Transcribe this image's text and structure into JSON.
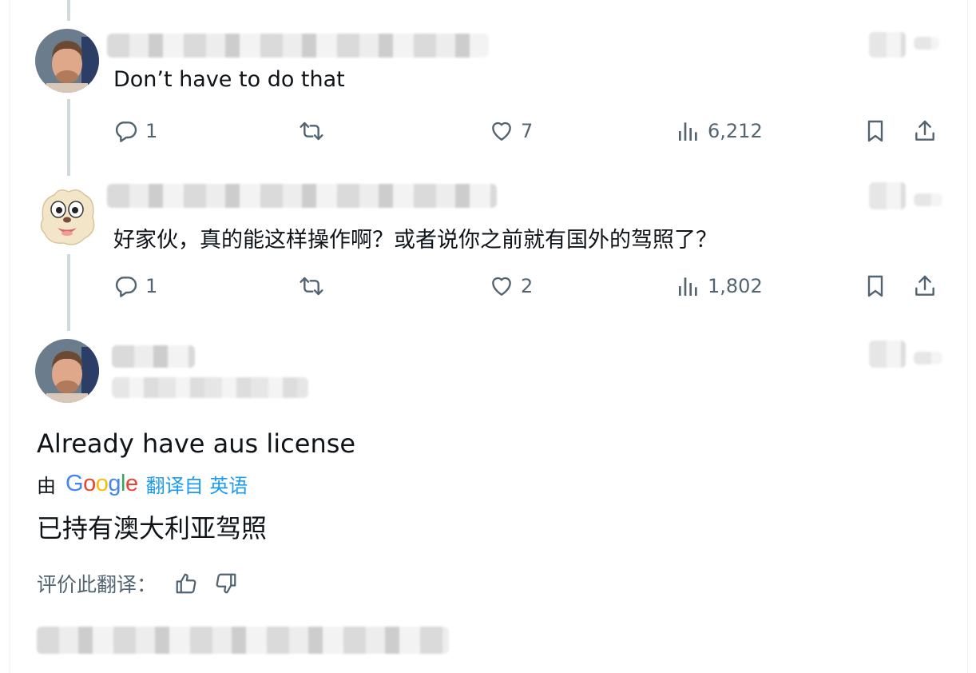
{
  "replies": [
    {
      "text": "Don’t have to do that",
      "replies": "1",
      "likes": "7",
      "views": "6,212"
    },
    {
      "text": "好家伙，真的能这样操作啊？或者说你之前就有国外的驾照了？",
      "replies": "1",
      "likes": "2",
      "views": "1,802"
    }
  ],
  "focused_tweet": {
    "text": "Already have aus license",
    "translation_prefix": "由",
    "translation_provider": "Google",
    "translation_label": "翻译自 英语",
    "translated_text": "已持有澳大利亚驾照",
    "rate_label": "评价此翻译："
  },
  "icons": {
    "reply": "reply-icon",
    "retweet": "retweet-icon",
    "like": "like-icon",
    "views": "views-icon",
    "bookmark": "bookmark-icon",
    "share": "share-icon",
    "thumbs_up": "thumbs-up-icon",
    "thumbs_down": "thumbs-down-icon"
  },
  "colors": {
    "icon_gray": "#536471",
    "link_blue": "#1d9bf0",
    "thread_line": "#cfd9de"
  }
}
